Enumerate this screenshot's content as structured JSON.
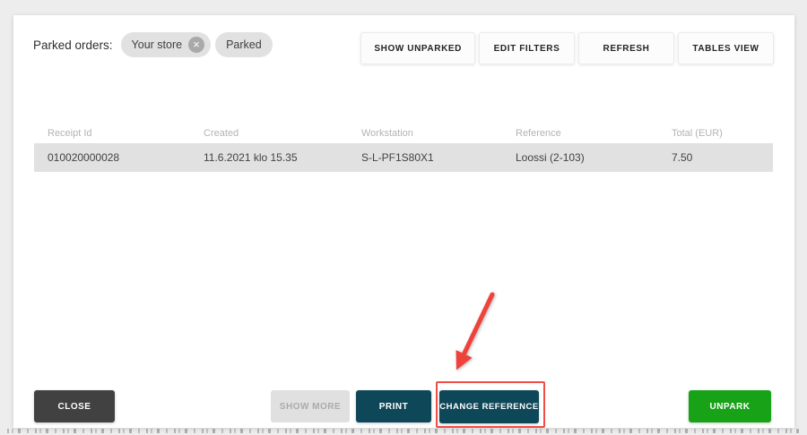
{
  "header": {
    "label": "Parked orders:",
    "chips": [
      {
        "label": "Your store",
        "removable": true
      },
      {
        "label": "Parked",
        "removable": false
      }
    ]
  },
  "icons": {
    "chip_remove": "×"
  },
  "toolbar": {
    "show_unparked": "SHOW UNPARKED",
    "edit_filters": "EDIT FILTERS",
    "refresh": "REFRESH",
    "tables_view": "TABLES VIEW"
  },
  "table": {
    "columns": [
      "Receipt Id",
      "Created",
      "Workstation",
      "Reference",
      "Total (EUR)"
    ],
    "rows": [
      {
        "receipt_id": "010020000028",
        "created": "11.6.2021 klo 15.35",
        "workstation": "S-L-PF1S80X1",
        "reference": "Loossi (2-103)",
        "total": "7.50"
      }
    ]
  },
  "footer": {
    "close": "CLOSE",
    "show_more": "SHOW MORE",
    "print": "PRINT",
    "change_reference": "CHANGE REFERENCE",
    "unpark": "UNPARK"
  },
  "annotation": {
    "target": "change-reference-button",
    "style": "red arrow and red outline"
  },
  "colors": {
    "teal": "#0e4758",
    "green": "#17a217",
    "dark": "#414141",
    "highlight_red": "#ef4c45",
    "arrow_red": "#ee423b",
    "chip_bg": "#e1e1e1",
    "row_bg": "#e1e1e1"
  }
}
